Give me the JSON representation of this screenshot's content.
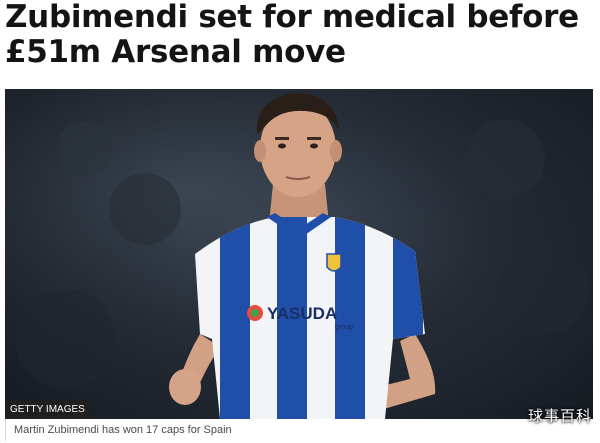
{
  "article": {
    "headline_line1": "Zubimendi set for medical before",
    "headline_line2": "£51m Arsenal move"
  },
  "image": {
    "credit": "GETTY IMAGES",
    "sponsor_text": "YASUDA",
    "sponsor_subtext": "group",
    "caption": "Martin Zubimendi has won 17 caps for Spain",
    "watermark": "球事百科"
  },
  "colors": {
    "headline": "#141414",
    "shirt_blue": "#1f4fa8",
    "shirt_white": "#f2f4f8",
    "background_dark": "#1e252e",
    "caption_text": "#4a4a4a"
  }
}
